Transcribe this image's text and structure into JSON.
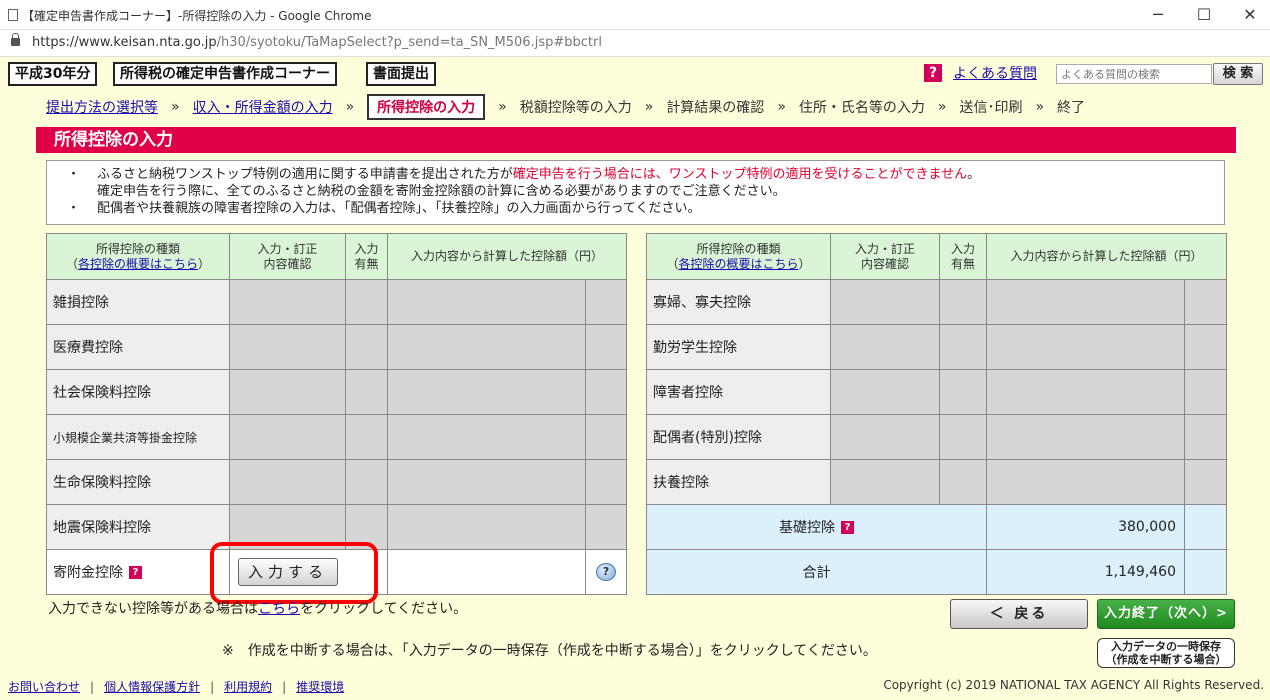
{
  "browser": {
    "window_title": "【確定申告書作成コーナー】-所得控除の入力 - Google Chrome",
    "url_host": "https://www.keisan.nta.go.jp",
    "url_path": "/h30/syotoku/TaMapSelect?p_send=ta_SN_M506.jsp#bbctrl",
    "min_glyph": "─",
    "max_glyph": "☐",
    "close_glyph": "✕"
  },
  "header": {
    "year_label": "平成30年分",
    "corner_label": "所得税の確定申告書作成コーナー",
    "mode_label": "書面提出",
    "help_icon_glyph": "?",
    "faq_link": "よくある質問",
    "search_placeholder": "よくある質問の検索",
    "search_button": "検 索"
  },
  "steps": [
    {
      "label": "提出方法の選択等",
      "state": "link"
    },
    {
      "label": "収入・所得金額の入力",
      "state": "link"
    },
    {
      "label": "所得控除の入力",
      "state": "current"
    },
    {
      "label": "税額控除等の入力",
      "state": "plain"
    },
    {
      "label": "計算結果の確認",
      "state": "plain"
    },
    {
      "label": "住所・氏名等の入力",
      "state": "plain"
    },
    {
      "label": "送信･印刷",
      "state": "plain"
    },
    {
      "label": "終了",
      "state": "plain"
    }
  ],
  "step_separator": "»",
  "section_title": "所得控除の入力",
  "notice": {
    "bullet": "・",
    "line1_a": "ふるさと納税ワンストップ特例の適用に関する申請書を提出された方が",
    "line1_red": "確定申告を行う場合には、ワンストップ特例の適用を受けることができません",
    "line1_b": "。",
    "line2": "確定申告を行う際に、全てのふるさと納税の金額を寄附金控除額の計算に含める必要がありますのでご注意ください。",
    "line3": "配偶者や扶養親族の障害者控除の入力は、「配偶者控除」、「扶養控除」の入力画面から行ってください。"
  },
  "table_headers": {
    "type": "所得控除の種類",
    "overview_link": "各控除の概要はこちら",
    "open_paren": "（",
    "close_paren": "）",
    "confirm": "入力・訂正\n内容確認",
    "confirm_l1": "入力・訂正",
    "confirm_l2": "内容確認",
    "has_input_l1": "入力",
    "has_input_l2": "有無",
    "amount": "入力内容から計算した控除額（円）"
  },
  "left_rows": [
    {
      "label": "雑損控除"
    },
    {
      "label": "医療費控除"
    },
    {
      "label": "社会保険料控除"
    },
    {
      "label": "小規模企業共済等掛金控除"
    },
    {
      "label": "生命保険料控除"
    },
    {
      "label": "地震保険料控除"
    },
    {
      "label": "寄附金控除",
      "button": "入力する",
      "help_glyph": "?"
    }
  ],
  "right_rows": [
    {
      "label": "寡婦、寡夫控除"
    },
    {
      "label": "勤労学生控除"
    },
    {
      "label": "障害者控除"
    },
    {
      "label": "配偶者(特別)控除"
    },
    {
      "label": "扶養控除"
    }
  ],
  "basic_deduction": {
    "label": "基礎控除",
    "amount": "380,000"
  },
  "total": {
    "label": "合計",
    "amount": "1,149,460"
  },
  "footnote": {
    "before": "入力できない控除等がある場合は",
    "link": "こちら",
    "after": "をクリックしてください。"
  },
  "buttons": {
    "back": "＜ 戻る",
    "next": "入力終了（次へ）>",
    "save_l1": "入力データの一時保存",
    "save_l2": "（作成を中断する場合）"
  },
  "interrupt_note": "※　作成を中断する場合は、「入力データの一時保存（作成を中断する場合）」をクリックしてください。",
  "footer": {
    "links": [
      "お問い合わせ",
      "個人情報保護方針",
      "利用規約",
      "推奨環境"
    ],
    "separator": "|",
    "copyright": "Copyright (c) 2019 NATIONAL TAX AGENCY All Rights Reserved."
  },
  "colors": {
    "brand_red": "#e00048",
    "page_bg": "#fffedb",
    "header_green": "#d9f5d6",
    "total_blue": "#dcf0fb"
  }
}
